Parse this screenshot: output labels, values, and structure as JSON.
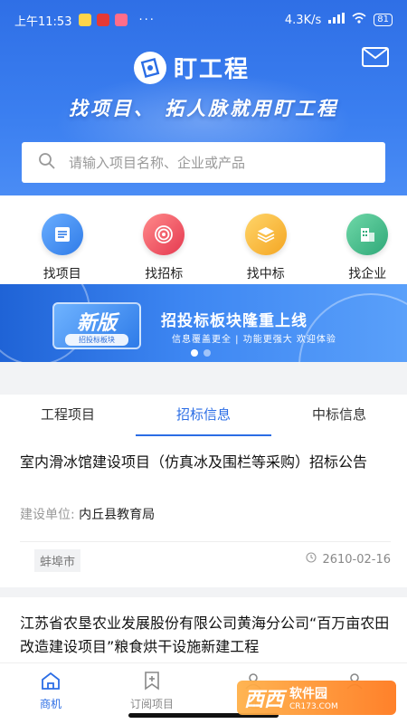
{
  "status_bar": {
    "time": "上午11:53",
    "dots": "···",
    "speed": "4.3K/s",
    "battery": "81"
  },
  "header": {
    "app_name": "盯工程",
    "slogan": "找项目、 拓人脉就用盯工程"
  },
  "search": {
    "placeholder": "请输入项目名称、企业或产品"
  },
  "quick_nav": [
    {
      "label": "找项目",
      "icon": "document-list-icon",
      "color": "#3d8bf0"
    },
    {
      "label": "找招标",
      "icon": "target-icon",
      "color": "#ef5b6b"
    },
    {
      "label": "找中标",
      "icon": "layers-icon",
      "color": "#f7b733"
    },
    {
      "label": "找企业",
      "icon": "building-icon",
      "color": "#3fb58a"
    }
  ],
  "banner": {
    "badge_title": "新版",
    "badge_sub": "招投标板块",
    "title": "招投标板块隆重上线",
    "subtitle": "信息覆盖更全 | 功能更强大   欢迎体验",
    "slides": 2,
    "active_slide": 1
  },
  "tabs": [
    {
      "label": "工程项目",
      "active": false
    },
    {
      "label": "招标信息",
      "active": true
    },
    {
      "label": "中标信息",
      "active": false
    }
  ],
  "listings": [
    {
      "title": "室内滑冰馆建设项目（仿真冰及围栏等采购）招标公告",
      "meta_label": "建设单位:",
      "meta_value": "内丘县教育局",
      "city": "蚌埠市",
      "date": "2610-02-16"
    },
    {
      "title": "江苏省农垦农业发展股份有限公司黄海分公司“百万亩农田改造建设项目”粮食烘干设施新建工程"
    }
  ],
  "bottom_nav": [
    {
      "label": "商机",
      "icon": "home-icon",
      "active": true
    },
    {
      "label": "订阅项目",
      "icon": "bookmark-plus-icon",
      "active": false
    },
    {
      "label": "近",
      "icon": "contact-icon",
      "active": false
    },
    {
      "label": "",
      "icon": "user-icon",
      "active": false
    }
  ],
  "watermark": {
    "main": "西西",
    "cn": "软件园",
    "en": "CR173.COM"
  },
  "colors": {
    "brand_blue": "#2b6de5",
    "header_blue": "#3b7ff0"
  }
}
